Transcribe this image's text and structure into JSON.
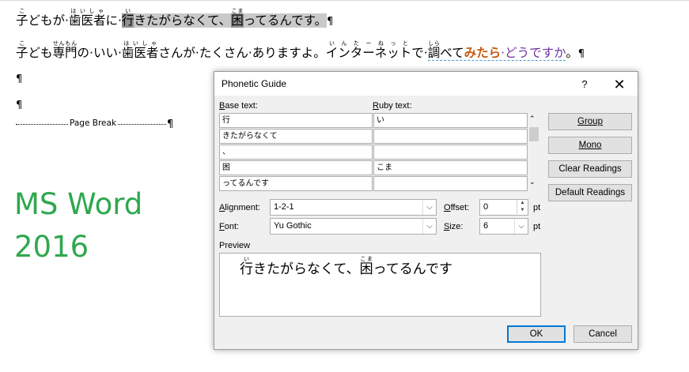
{
  "document": {
    "line1": {
      "seg_a_base": "子",
      "seg_a_ruby": "こ",
      "seg_b": "どもが·",
      "seg_c_base": "歯医者",
      "seg_c_ruby": "はいしゃ",
      "seg_d": "に·",
      "seg_e_base": "行",
      "seg_e_ruby": "い",
      "seg_f": "きたがらなくて、",
      "seg_g_base": "困",
      "seg_g_ruby": "こま",
      "seg_h": "ってるんです。",
      "pilcrow": "¶"
    },
    "line2": {
      "seg_a_base": "子",
      "seg_a_ruby": "こ",
      "seg_b": "ども",
      "seg_c_base": "専門",
      "seg_c_ruby": "せんもん",
      "seg_d": "の·いい·",
      "seg_e_base": "歯医者",
      "seg_e_ruby": "はいしゃ",
      "seg_f": "さんが·たくさん·ありますよ。",
      "seg_g_base": "インターネット",
      "seg_g_ruby": "いんたーねっと",
      "seg_h": "で·",
      "seg_i_base": "調",
      "seg_i_ruby": "しら",
      "seg_j": "べて",
      "seg_k": "みたら",
      "seg_l": "·どうですか",
      "seg_m": "。",
      "pilcrow": "¶"
    },
    "empty_para_1": "¶",
    "empty_para_2": "¶",
    "page_break": "Page Break",
    "page_break_pilcrow": "¶",
    "overlay_line1": "MS Word",
    "overlay_line2": "2016",
    "colors": {
      "overlay": "#2fa84f",
      "orange": "#c55a11",
      "purple": "#7030a0",
      "underline": "#4a9ad4"
    }
  },
  "dialog": {
    "title": "Phonetic Guide",
    "help_label": "?",
    "close_label": "✕",
    "base_text_label_u": "B",
    "base_text_label_rest": "ase text:",
    "ruby_text_label_u": "R",
    "ruby_text_label_rest": "uby text:",
    "rows": [
      {
        "base": "行",
        "ruby": "い"
      },
      {
        "base": "きたがらなくて",
        "ruby": ""
      },
      {
        "base": "、",
        "ruby": ""
      },
      {
        "base": "困",
        "ruby": "こま"
      },
      {
        "base": "ってるんです",
        "ruby": ""
      }
    ],
    "scroll_up": "⌃",
    "scroll_down": "⌄",
    "buttons": {
      "group": "Group",
      "mono": "Mono",
      "clear_readings": "Clear Readings",
      "default_readings": "Default Readings",
      "ok": "OK",
      "cancel": "Cancel"
    },
    "alignment_label_u": "A",
    "alignment_label_rest": "lignment:",
    "alignment_value": "1-2-1",
    "offset_label_u": "O",
    "offset_label_rest": "ffset:",
    "offset_value": "0",
    "offset_unit": "pt",
    "font_label_u": "F",
    "font_label_rest": "ont:",
    "font_value": "Yu Gothic",
    "size_label_u": "S",
    "size_label_rest": "ize:",
    "size_value": "6",
    "size_unit": "pt",
    "preview_label": "Preview",
    "preview": {
      "a_base": "行",
      "a_ruby": "い",
      "b": "きたがらなくて、",
      "c_base": "困",
      "c_ruby": "こま",
      "d": "ってるんです"
    },
    "accent_color": "#0078d7"
  }
}
